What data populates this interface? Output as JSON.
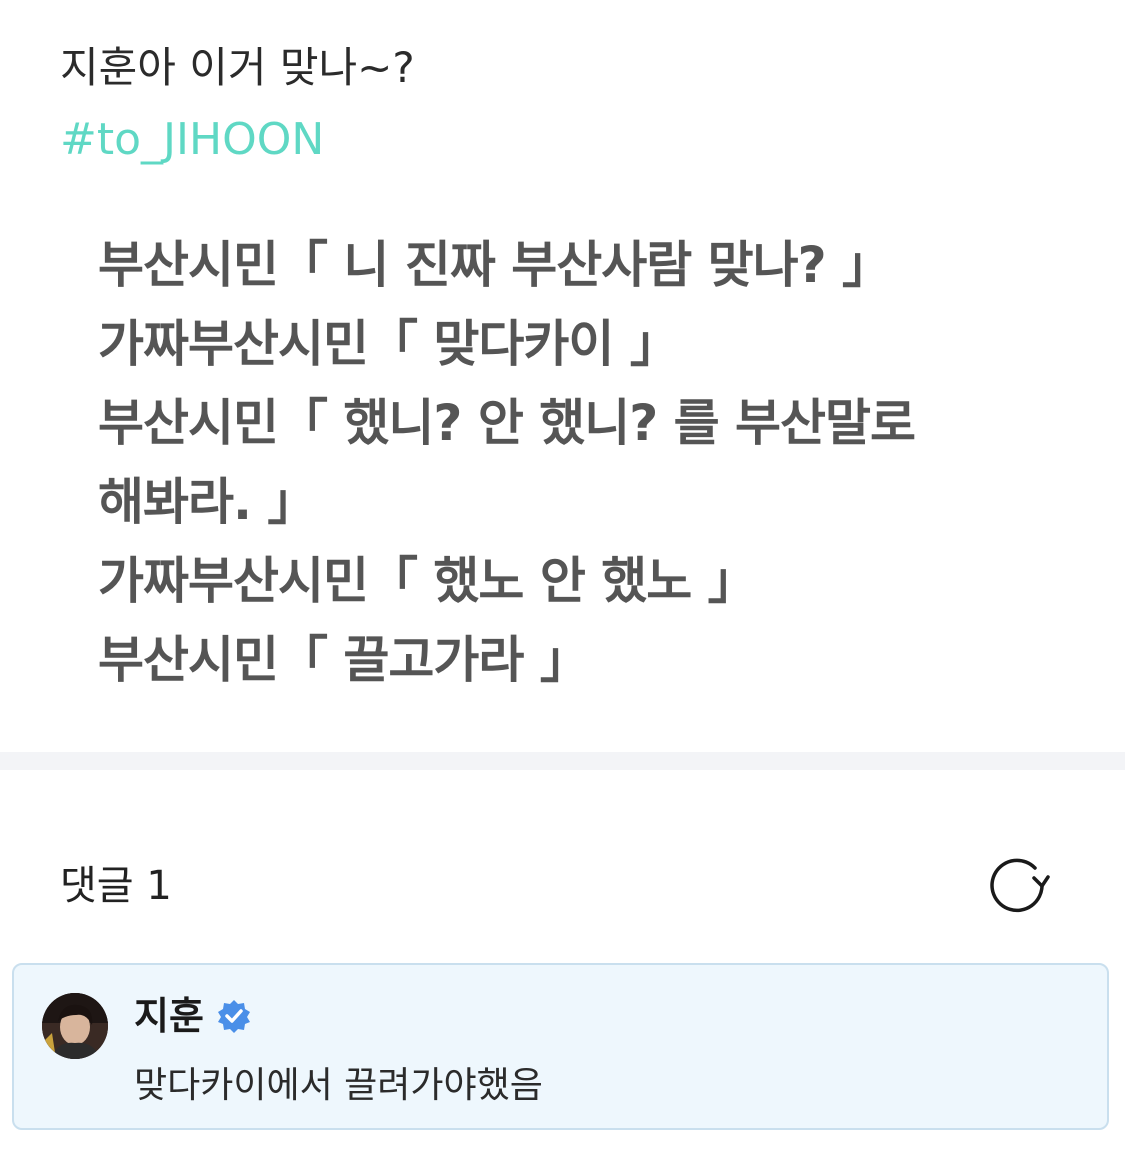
{
  "post": {
    "text": "지훈아 이거 맞나~?",
    "hashtag": "#to_JIHOON"
  },
  "image_text": {
    "lines": [
      "부산시민「 니 진짜 부산사람 맞나? 」",
      "가짜부산시민「 맞다카이 」",
      "부산시민「 했니? 안 했니? 를 부산말로",
      "해봐라. 」",
      "가짜부산시민「 했노 안 했노 」",
      "부산시민「 끌고가라 」"
    ]
  },
  "comments": {
    "count_label": "댓글 1",
    "refresh_icon": "refresh-icon",
    "items": [
      {
        "author": "지훈",
        "verified": true,
        "verified_icon": "verified-badge-icon",
        "text": "맞다카이에서 끌려가야했음"
      }
    ]
  },
  "colors": {
    "hashtag": "#5fd8c4",
    "verified": "#4a8fe8",
    "comment_bg": "#eef7fd",
    "comment_border": "#c9dfee",
    "divider": "#f3f4f7"
  }
}
